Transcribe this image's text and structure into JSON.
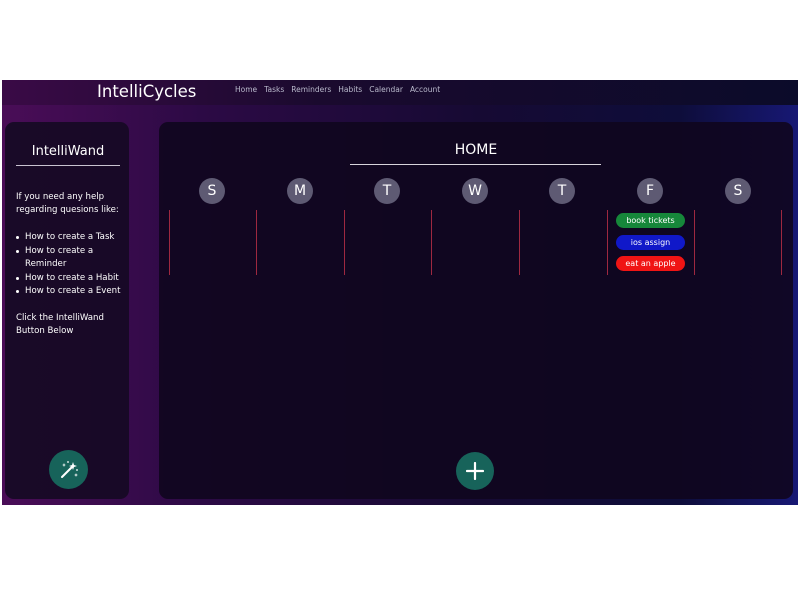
{
  "header": {
    "brand": "IntelliCycles",
    "nav": [
      "Home",
      "Tasks",
      "Reminders",
      "Habits",
      "Calendar",
      "Account"
    ]
  },
  "sidebar": {
    "title": "IntelliWand",
    "intro_line1": "If you need any help",
    "intro_line2": "regarding quesions like:",
    "help_items": [
      "How to create a Task",
      "How to create a",
      "Reminder",
      "How to create a Habit",
      "How to create a Event"
    ],
    "outro_line1": "Click the IntelliWand",
    "outro_line2": "Button Below",
    "wand_icon": "magic-wand-icon"
  },
  "main": {
    "title": "HOME",
    "days": [
      "S",
      "M",
      "T",
      "W",
      "T",
      "F",
      "S"
    ],
    "events": [
      {
        "label": "book tickets",
        "color": "#16873a",
        "day": "F"
      },
      {
        "label": "ios assign",
        "color": "#1018c9",
        "day": "F"
      },
      {
        "label": "eat an apple",
        "color": "#f01414",
        "day": "F"
      }
    ],
    "add_icon": "plus-icon"
  },
  "colors": {
    "accent_button": "#17635a",
    "day_circle": "#5e5a73",
    "separator": "#9e2840"
  }
}
